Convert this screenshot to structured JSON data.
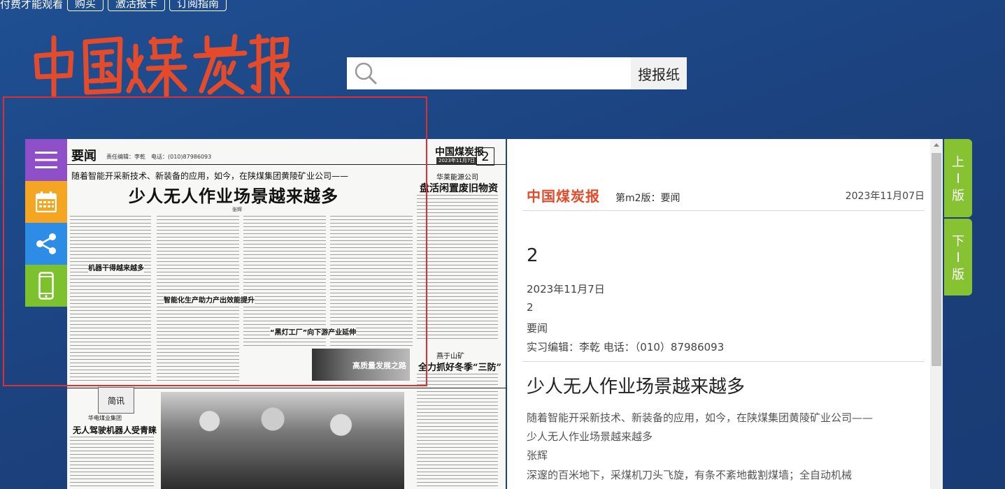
{
  "topbar": {
    "notice": "付费才能观看",
    "buttons": [
      "购买",
      "激活报卡",
      "订阅指南"
    ]
  },
  "logo": {
    "text": "中国煤炭报",
    "color": "#e44b2a"
  },
  "search": {
    "placeholder": "",
    "button_label": "搜报纸"
  },
  "tools": {
    "icons": [
      "menu-icon",
      "calendar-icon",
      "share-icon",
      "mobile-icon"
    ],
    "colors": [
      "#8e4fc8",
      "#f4a623",
      "#2d8de6",
      "#7dc12f"
    ]
  },
  "paper": {
    "section": "要闻",
    "editor_line": "责任编辑：李乾　电话：(010)87986093",
    "page_number": "2",
    "mini_logo": "中国煤炭报",
    "mini_date": "2023年11月7日",
    "kicker": "随着智能开采新技术、新装备的应用，如今，在陕煤集团黄陵矿业公司——",
    "headline": "少人无人作业场景越来越多",
    "author": "张辉",
    "sec1": "机器干得越来越多",
    "sec2": "智能化生产助力产出效能提升",
    "sec3": "“黑灯工厂”向下游产业延伸",
    "rcol_kicker": "华莱能源公司",
    "rcol_title": "盘活闲置废旧物资",
    "brand_img_text": "高质量发展之路",
    "rcol2_kicker": "燕于山矿",
    "rcol2_title": "全力抓好冬季“三防”",
    "brief_tag": "简讯",
    "brief_sub": "华电煤业集团",
    "brief_title": "无人驾驶机器人受青睐"
  },
  "article": {
    "logo": "中国煤炭报",
    "edition": "第m2版：要闻",
    "date": "2023年11月07日",
    "page_num": "2",
    "meta_date": "2023年11月7日",
    "meta_num": "2",
    "meta_section": "要闻",
    "meta_editor": "实习编辑：李乾 电话：（010）87986093",
    "title": "少人无人作业场景越来越多",
    "lines": [
      "随着智能开采新技术、新装备的应用，如今，在陕煤集团黄陵矿业公司——",
      "少人无人作业场景越来越多",
      "张辉",
      "深邃的百米地下，采煤机刀头飞旋，有条不紊地截割煤墙；全自动机械"
    ]
  },
  "pagenav": {
    "prev": [
      "上",
      "版"
    ],
    "next": [
      "下",
      "版"
    ],
    "color": "#86c232"
  }
}
